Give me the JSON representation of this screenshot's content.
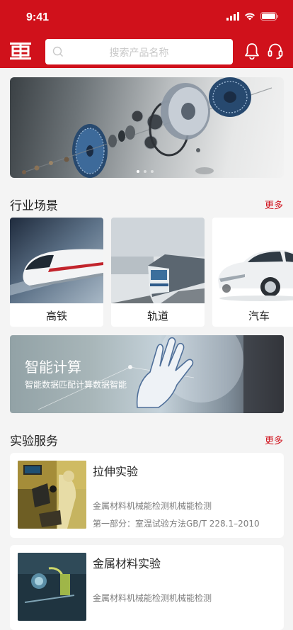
{
  "status_bar": {
    "time": "9:41"
  },
  "header": {
    "logo": "crrc-logo",
    "search_placeholder": "搜索产品名称",
    "icons": [
      "bell-icon",
      "headset-icon"
    ],
    "brand_color": "#d0111b"
  },
  "banner": {
    "slides": 3,
    "active_slide": 1
  },
  "industry": {
    "title": "行业场景",
    "more": "更多",
    "items": [
      {
        "label": "高铁"
      },
      {
        "label": "轨道"
      },
      {
        "label": "汽车"
      }
    ]
  },
  "promo": {
    "title": "智能计算",
    "subtitle": "智能数据匹配计算数据智能"
  },
  "services": {
    "title": "实验服务",
    "more": "更多",
    "items": [
      {
        "title": "拉伸实验",
        "desc1": "金属材料机械能检测机械能检测",
        "desc2": "第一部分：室温试验方法GB/T 228.1–2010"
      },
      {
        "title": "金属材料实验",
        "desc1": "金属材料机械能检测机械能检测",
        "desc2": ""
      }
    ]
  }
}
